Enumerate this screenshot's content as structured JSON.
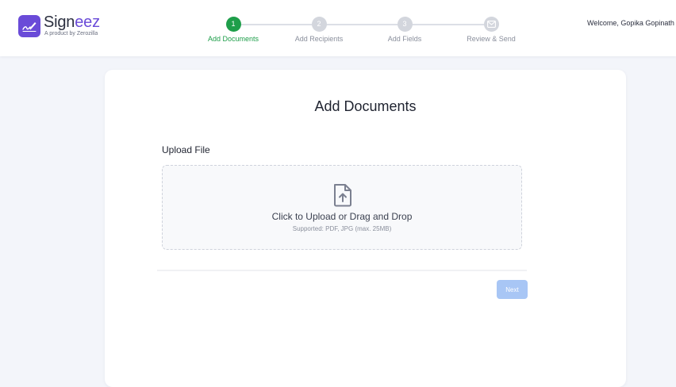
{
  "brand": {
    "name_part1": "Sign",
    "name_part2": "eez",
    "tagline": "A product by Zerozilla",
    "accent_color": "#6a4bd8"
  },
  "stepper": {
    "active_color": "#1e9e4a",
    "steps": [
      {
        "number": "1",
        "label": "Add Documents",
        "active": true
      },
      {
        "number": "2",
        "label": "Add Recipients",
        "active": false
      },
      {
        "number": "3",
        "label": "Add Fields",
        "active": false
      },
      {
        "icon": "envelope-icon",
        "label": "Review & Send",
        "active": false
      }
    ]
  },
  "header": {
    "welcome_text": "Welcome, Gopika Gopinath"
  },
  "main": {
    "title": "Add Documents",
    "upload_label": "Upload File",
    "dropzone": {
      "icon": "file-upload-icon",
      "primary_text": "Click to Upload or Drag and Drop",
      "secondary_text": "Supported: PDF, JPG (max. 25MB)"
    },
    "next_button": {
      "label": "Next",
      "color": "#a8c6f5",
      "disabled": true
    }
  }
}
